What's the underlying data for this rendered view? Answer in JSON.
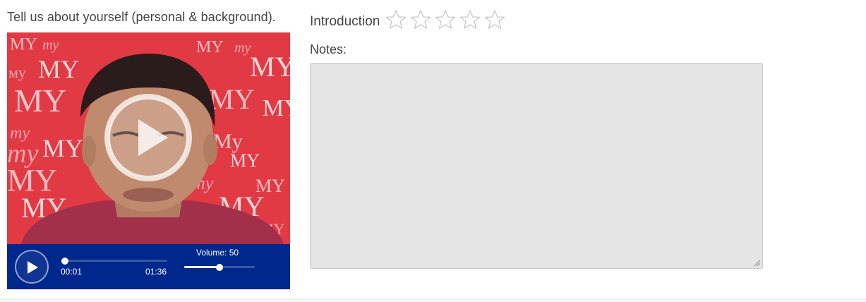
{
  "question": {
    "text": "Tell us about yourself (personal & background)."
  },
  "video": {
    "current_time": "00:01",
    "total_time": "01:36",
    "progress": 0.01,
    "volume_label": "Volume: 50",
    "volume": 0.5,
    "accent_color": "#00288c",
    "play_icon": "play-icon",
    "backdrop_text": "MY"
  },
  "rating": {
    "label": "Introduction",
    "max_stars": 5,
    "selected": 0,
    "star_icon": "star-outline-icon"
  },
  "notes": {
    "label": "Notes:",
    "value": "",
    "placeholder": ""
  }
}
